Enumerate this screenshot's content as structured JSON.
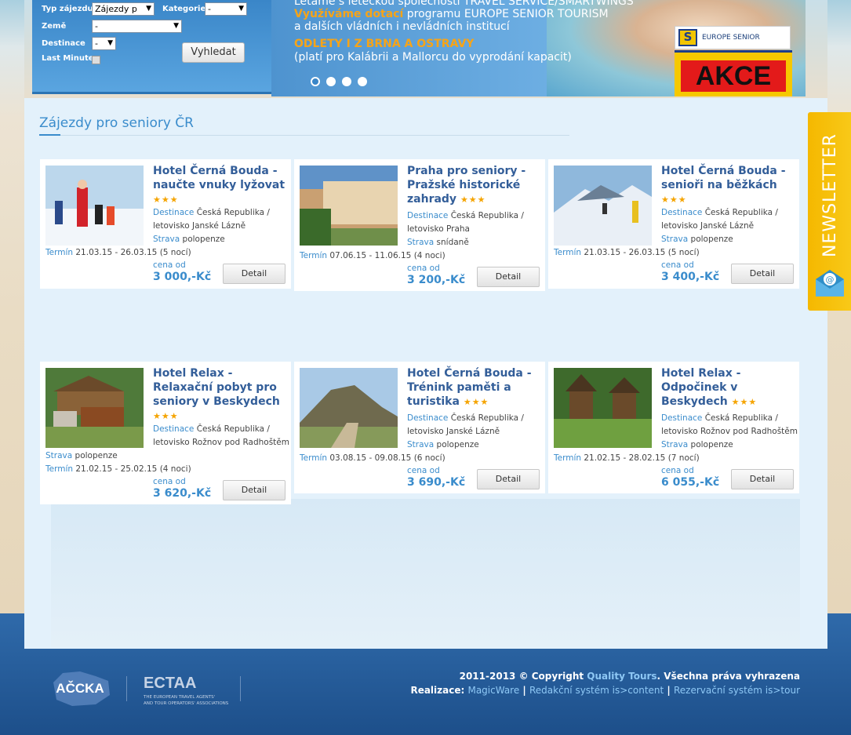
{
  "search": {
    "type_label": "Typ zájezdu",
    "type_value": "Zájezdy p",
    "category_label": "Kategorie",
    "category_value": "-",
    "country_label": "Země",
    "country_value": "-",
    "destination_label": "Destinace",
    "destination_value": "-",
    "lastminute_label": "Last Minute",
    "search_button": "Vyhledat"
  },
  "banner": {
    "line1": "Letáme s leteckou společností TRAVEL SERVICE/SMARTWINGS",
    "line2_highlight": "Využíváme dotací",
    "line2_rest": " programu EUROPE SENIOR TOURISM",
    "line3": "a dalších vládních i nevládních institucí",
    "line4": "ODLETY I Z BRNA A OSTRAVY",
    "line5": "(platí pro Kalábrii a Mallorcu do vyprodání kapacit)",
    "badge_text": "EUROPE SENIOR TOURISM",
    "badge_logo_letter": "S",
    "akce": "AKCE",
    "active_slide": 1,
    "slide_count": 4
  },
  "section": {
    "title": "Zájezdy pro seniory ČR"
  },
  "labels": {
    "destination": "Destinace",
    "food": "Strava",
    "term": "Termín",
    "price_from": "cena od",
    "detail": "Detail"
  },
  "tours": [
    {
      "name": "Hotel Černá Bouda - naučte vnuky lyžovat",
      "stars": "★★★",
      "destination": "Česká Republika / letovisko Janské Lázně",
      "destination_line1": "Česká Republika /",
      "destination_line2": "letovisko Janské Lázně",
      "food": "polopenze",
      "term": "21.03.15 - 26.03.15 (5 nocí)",
      "price": "3 000,-Kč"
    },
    {
      "name": "Praha pro seniory - Pražské historické zahrady",
      "stars": "★★★",
      "destination_line1": "Česká Republika /",
      "destination_line2": "letovisko Praha",
      "food": "snídaně",
      "term": "07.06.15 - 11.06.15 (4 noci)",
      "price": "3 200,-Kč"
    },
    {
      "name": "Hotel Černá Bouda - senioři na běžkách",
      "stars": "★★★",
      "destination_line1": "Česká Republika /",
      "destination_line2": "letovisko Janské Lázně",
      "food": "polopenze",
      "term": "21.03.15 - 26.03.15 (5 nocí)",
      "price": "3 400,-Kč"
    },
    {
      "name": "Hotel Relax - Relaxační pobyt pro seniory v Beskydech",
      "stars": "★★★",
      "destination_line1": "Česká Republika /",
      "destination_line2": "letovisko Rožnov pod Radhoštěm",
      "food": "polopenze",
      "term": "21.02.15 - 25.02.15 (4 noci)",
      "price": "3 620,-Kč"
    },
    {
      "name": "Hotel Černá Bouda - Trénink paměti a turistika",
      "stars": "★★★",
      "destination_line1": "Česká Republika /",
      "destination_line2": "letovisko Janské Lázně",
      "food": "polopenze",
      "term": "03.08.15 - 09.08.15 (6 nocí)",
      "price": "3 690,-Kč"
    },
    {
      "name": "Hotel Relax - Odpočinek v Beskydech",
      "stars": "★★★",
      "destination_line1": "Česká Republika /",
      "destination_line2": "letovisko Rožnov pod Radhoštěm",
      "food": "polopenze",
      "term": "21.02.15 - 28.02.15 (7 nocí)",
      "price": "6 055,-Kč"
    }
  ],
  "newsletter": {
    "label": "NEWSLETTER"
  },
  "footer": {
    "logo1": "AČCKA",
    "logo2_title": "ECTAA",
    "logo2_sub1": "THE EUROPEAN TRAVEL AGENTS'",
    "logo2_sub2": "AND TOUR OPERATORS' ASSOCIATIONS",
    "copyright_prefix": "2011-2013 © Copyright ",
    "company": "Quality Tours",
    "copyright_suffix": ". Všechna práva vyhrazena",
    "realization": "Realizace: ",
    "link1": "MagicWare",
    "sep": " | ",
    "link2": "Redakční systém is>content",
    "link3": "Rezervační systém is>tour"
  }
}
